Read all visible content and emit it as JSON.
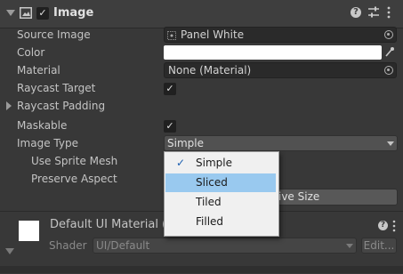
{
  "component": {
    "title": "Image",
    "enabled_mark": "✓",
    "header_icons": [
      "help-icon",
      "preset-sliders-icon",
      "kebab-menu-icon"
    ]
  },
  "fields": {
    "source_image": {
      "label": "Source Image",
      "value": "Panel White"
    },
    "color": {
      "label": "Color",
      "value": "#ffffff"
    },
    "material": {
      "label": "Material",
      "value": "None (Material)"
    },
    "raycast_target": {
      "label": "Raycast Target",
      "checked_mark": "✓"
    },
    "raycast_padding": {
      "label": "Raycast Padding"
    },
    "maskable": {
      "label": "Maskable",
      "checked_mark": "✓"
    },
    "image_type": {
      "label": "Image Type",
      "value": "Simple"
    },
    "use_sprite_mesh": {
      "label": "Use Sprite Mesh"
    },
    "preserve_aspect": {
      "label": "Preserve Aspect"
    },
    "native_size_button": {
      "label_visible": "ive Size"
    }
  },
  "dropdown_menu": {
    "check_mark": "✓",
    "items": [
      "Simple",
      "Sliced",
      "Tiled",
      "Filled"
    ],
    "checked_index": 0,
    "highlighted_index": 1
  },
  "material_section": {
    "title": "Default UI Material (M",
    "shader_label": "Shader",
    "shader_value": "UI/Default",
    "edit_button": "Edit..."
  },
  "colors": {
    "background": "#383838",
    "menu_highlight": "#99c9ef",
    "menu_background": "#f0f0f0"
  }
}
